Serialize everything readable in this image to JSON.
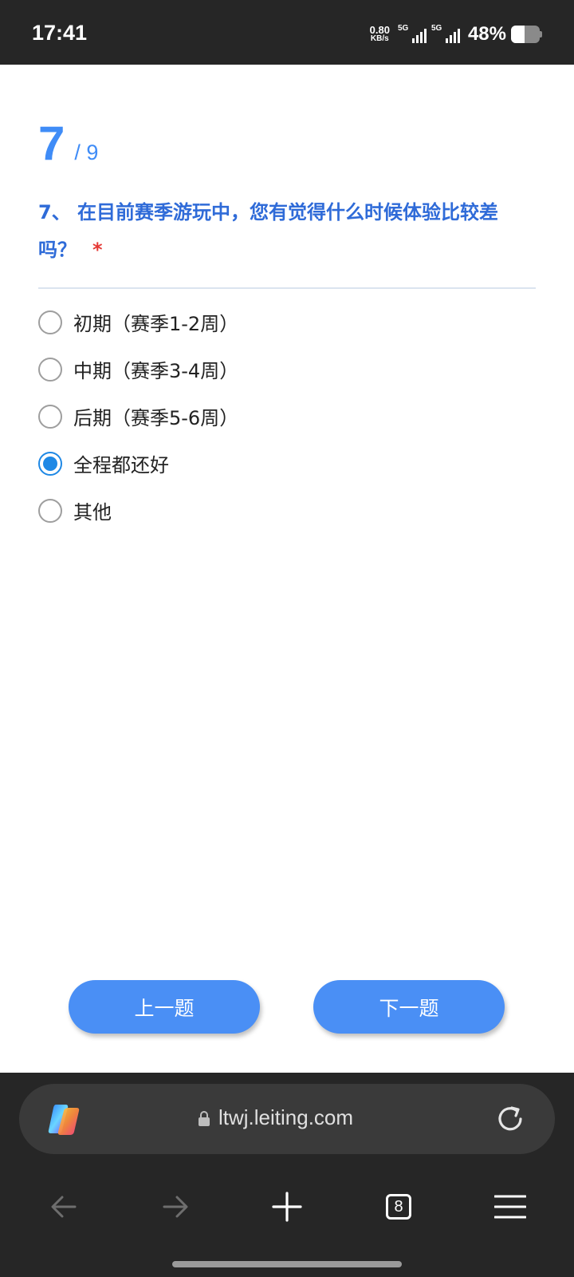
{
  "status_bar": {
    "time": "17:41",
    "net_speed_value": "0.80",
    "net_speed_unit": "KB/s",
    "sim1_label": "5G",
    "sim2_label": "5G",
    "battery_percent": "48%",
    "battery_level": 0.48
  },
  "survey": {
    "progress_current": "7",
    "progress_total": "/ 9",
    "question": "7、 在目前赛季游玩中，您有觉得什么时候体验比较差吗？",
    "required_mark": "*",
    "options": [
      {
        "label": "初期（赛季1-2周）",
        "selected": false
      },
      {
        "label": "中期（赛季3-4周）",
        "selected": false
      },
      {
        "label": "后期（赛季5-6周）",
        "selected": false
      },
      {
        "label": "全程都还好",
        "selected": true
      },
      {
        "label": "其他",
        "selected": false
      }
    ],
    "prev_label": "上一题",
    "next_label": "下一题"
  },
  "browser": {
    "url": "ltwj.leiting.com",
    "tab_count": "8"
  },
  "colors": {
    "accent": "#4a8ff5",
    "question_text": "#2f6bd8",
    "required": "#e53935",
    "radio_selected": "#1e88e5",
    "chrome_bg": "#262626"
  },
  "icons": {
    "copilot": "copilot-icon",
    "lock": "lock-icon",
    "reload": "reload-icon",
    "back": "back-arrow-icon",
    "forward": "forward-arrow-icon",
    "new_tab": "plus-icon",
    "tabs": "tab-switcher-icon",
    "menu": "hamburger-menu-icon"
  }
}
